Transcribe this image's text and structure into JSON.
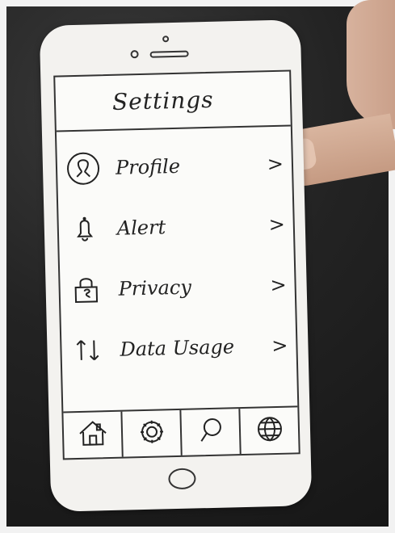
{
  "screen": {
    "title": "Settings",
    "menu": [
      {
        "label": "Profile",
        "icon": "profile-icon",
        "chevron": ">"
      },
      {
        "label": "Alert",
        "icon": "bell-icon",
        "chevron": ">"
      },
      {
        "label": "Privacy",
        "icon": "lock-icon",
        "chevron": ">"
      },
      {
        "label": "Data Usage",
        "icon": "data-usage-icon",
        "chevron": ">"
      }
    ],
    "tabs": [
      {
        "icon": "home-icon"
      },
      {
        "icon": "gear-icon"
      },
      {
        "icon": "search-icon"
      },
      {
        "icon": "globe-icon"
      }
    ]
  }
}
